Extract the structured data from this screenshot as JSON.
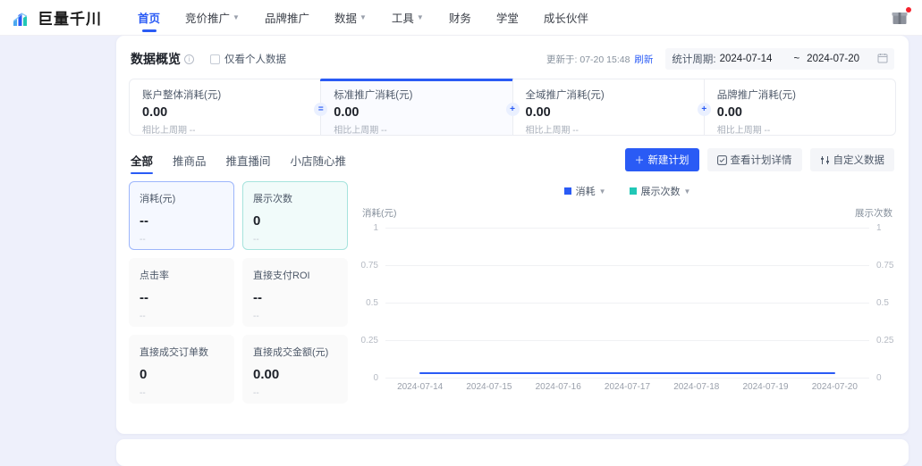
{
  "header": {
    "logo_text": "巨量千川",
    "logo_icon": "bar-chart-logo-icon",
    "nav": [
      {
        "label": "首页",
        "active": true,
        "caret": false
      },
      {
        "label": "竞价推广",
        "active": false,
        "caret": true
      },
      {
        "label": "品牌推广",
        "active": false,
        "caret": false
      },
      {
        "label": "数据",
        "active": false,
        "caret": true
      },
      {
        "label": "工具",
        "active": false,
        "caret": true
      },
      {
        "label": "财务",
        "active": false,
        "caret": false
      },
      {
        "label": "学堂",
        "active": false,
        "caret": false
      },
      {
        "label": "成长伙伴",
        "active": false,
        "caret": false
      }
    ],
    "gift_icon": "gift-icon",
    "gift_badge": true
  },
  "overview": {
    "title": "数据概览",
    "info_icon": "info-icon",
    "checkbox_label": "仅看个人数据",
    "checkbox_checked": false,
    "updated_label": "更新于: 07-20 15:48",
    "refresh_label": "刷新",
    "period_label": "统计周期:",
    "period_start": "2024-07-14",
    "period_sep": "~",
    "period_end": "2024-07-20",
    "calendar_icon": "calendar-icon",
    "cards": [
      {
        "title": "账户整体消耗(元)",
        "value": "0.00",
        "sub": "相比上周期 --",
        "selected": false,
        "op": "="
      },
      {
        "title": "标准推广消耗(元)",
        "value": "0.00",
        "sub": "相比上周期 --",
        "selected": true,
        "op": "+"
      },
      {
        "title": "全域推广消耗(元)",
        "value": "0.00",
        "sub": "相比上周期 --",
        "selected": false,
        "op": "+"
      },
      {
        "title": "品牌推广消耗(元)",
        "value": "0.00",
        "sub": "相比上周期 --",
        "selected": false,
        "op": ""
      }
    ]
  },
  "tabs": [
    {
      "label": "全部",
      "active": true
    },
    {
      "label": "推商品",
      "active": false
    },
    {
      "label": "推直播间",
      "active": false
    },
    {
      "label": "小店随心推",
      "active": false
    }
  ],
  "actions": {
    "create_plan": "新建计划",
    "create_plan_icon": "plus-icon",
    "view_detail": "查看计划详情",
    "view_detail_icon": "checkbox-square-icon",
    "custom_data": "自定义数据",
    "custom_data_icon": "sliders-icon"
  },
  "tiles": [
    {
      "title": "消耗(元)",
      "value": "--",
      "sub": "--",
      "state": "sel-blue"
    },
    {
      "title": "展示次数",
      "value": "0",
      "sub": "--",
      "state": "sel-teal"
    },
    {
      "title": "点击率",
      "value": "--",
      "sub": "--",
      "state": ""
    },
    {
      "title": "直接支付ROI",
      "value": "--",
      "sub": "--",
      "state": ""
    },
    {
      "title": "直接成交订单数",
      "value": "0",
      "sub": "--",
      "state": ""
    },
    {
      "title": "直接成交金额(元)",
      "value": "0.00",
      "sub": "--",
      "state": ""
    }
  ],
  "colors": {
    "accent": "#2a5bf5",
    "series1": "#2a5bf5",
    "series2": "#21c7b6",
    "page_bg": "#eef0fb",
    "badge_red": "#f5222d"
  },
  "chart_data": {
    "type": "line",
    "title": "",
    "legend": [
      {
        "name": "消耗",
        "color": "#2a5bf5",
        "caret": true
      },
      {
        "name": "展示次数",
        "color": "#21c7b6",
        "caret": true
      }
    ],
    "legend_position": "top-center",
    "left_axis_name": "消耗(元)",
    "right_axis_name": "展示次数",
    "x": [
      "2024-07-14",
      "2024-07-15",
      "2024-07-16",
      "2024-07-17",
      "2024-07-18",
      "2024-07-19",
      "2024-07-20"
    ],
    "yticks_left": [
      "1",
      "0.75",
      "0.5",
      "0.25",
      "0"
    ],
    "yticks_right": [
      "1",
      "0.75",
      "0.5",
      "0.25",
      "0"
    ],
    "ylim": [
      0,
      1
    ],
    "y2lim": [
      0,
      1
    ],
    "grid": true,
    "series": [
      {
        "name": "消耗",
        "color": "#2a5bf5",
        "axis": "left",
        "values": [
          0,
          0,
          0,
          0,
          0,
          0,
          0
        ]
      },
      {
        "name": "展示次数",
        "color": "#21c7b6",
        "axis": "right",
        "values": [
          0,
          0,
          0,
          0,
          0,
          0,
          0
        ]
      }
    ]
  }
}
